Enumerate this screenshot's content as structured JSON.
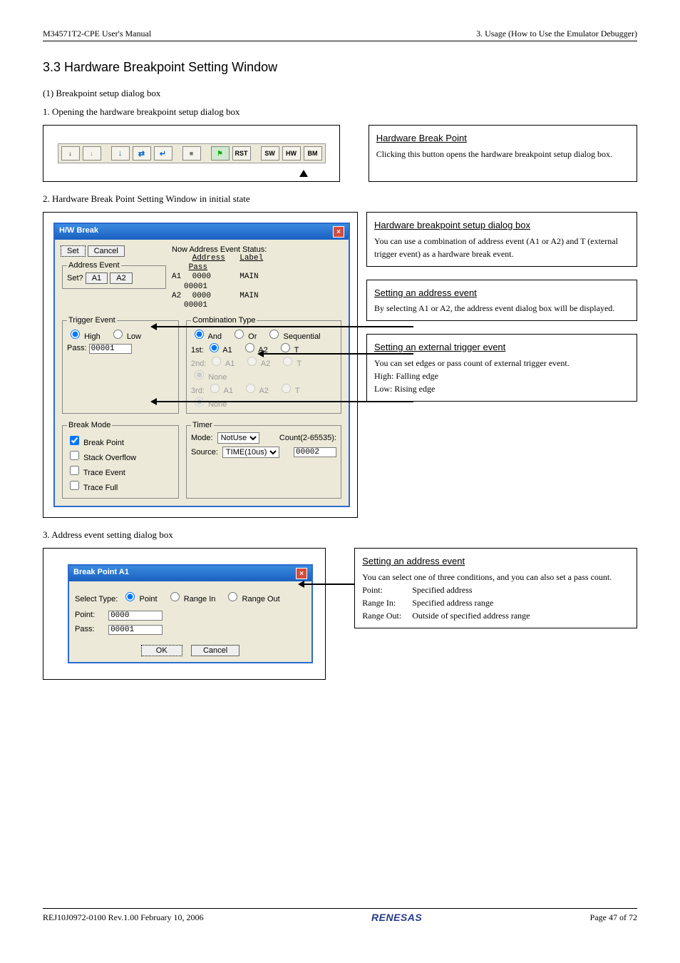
{
  "header": {
    "left": "M34571T2-CPE User's Manual",
    "right": "3. Usage (How to Use the Emulator Debugger)"
  },
  "section_title": "3.3 Hardware Breakpoint Setting Window",
  "p1": {
    "heading": "(1) Breakpoint setup dialog box",
    "step": "1. Opening the hardware breakpoint setup dialog box"
  },
  "toolbar": {
    "rst": "RST",
    "sw": "SW",
    "hw": "HW",
    "bm": "BM"
  },
  "callout_tb": {
    "title": "Hardware Break Point",
    "body": "Clicking this button opens the hardware breakpoint setup dialog box."
  },
  "step2": "2. Hardware Break Point Setting Window in initial state",
  "hw_win": {
    "title": "H/W Break",
    "set": "Set",
    "cancel": "Cancel",
    "addr_event": "Address Event",
    "set_q": "Set?",
    "a1": "A1",
    "a2": "A2",
    "status_label": "Now Address Event Status:",
    "status_hdr_addr": "Address",
    "status_hdr_label": "Label",
    "status_hdr_pass": "Pass",
    "status_rows": [
      {
        "ch": "A1",
        "addr": "0000",
        "label": "MAIN",
        "pass": "00001"
      },
      {
        "ch": "A2",
        "addr": "0000",
        "label": "MAIN",
        "pass": "00001"
      }
    ],
    "trigger_event": "Trigger Event",
    "high": "High",
    "low": "Low",
    "pass_lbl": "Pass:",
    "pass_val": "00001",
    "comb": "Combination Type",
    "and": "And",
    "or": "Or",
    "seq": "Sequential",
    "first": "1st:",
    "second": "2nd:",
    "third": "3rd:",
    "a1o": "A1",
    "a2o": "A2",
    "t": "T",
    "none": "None",
    "break_mode": "Break Mode",
    "bp": "Break Point",
    "so": "Stack Overflow",
    "te": "Trace Event",
    "tf": "Trace Full",
    "timer": "Timer",
    "mode": "Mode:",
    "mode_val": "NotUse",
    "count_lbl": "Count(2-65535):",
    "source": "Source:",
    "source_val": "TIME(10us)",
    "count_val": "00002"
  },
  "callouts2": [
    {
      "title": "Hardware breakpoint setup dialog box",
      "body": "You can use a combination of address event (A1 or A2) and T (external trigger event) as a hardware break event."
    },
    {
      "title": "Setting an address event",
      "body": "By selecting A1 or A2, the address event dialog box will be displayed."
    },
    {
      "title": "Setting an external trigger event",
      "body": "You can set edges or pass count of external trigger event.",
      "l1": "High: Falling edge",
      "l2": "Low: Rising edge"
    }
  ],
  "step3": "3. Address event setting dialog box",
  "bp_win": {
    "title": "Break Point A1",
    "select_type": "Select Type:",
    "point": "Point",
    "range_in": "Range In",
    "range_out": "Range Out",
    "point_lbl": "Point:",
    "point_val": "0000",
    "pass_lbl": "Pass:",
    "pass_val": "00001",
    "ok": "OK",
    "cancel": "Cancel"
  },
  "callout3": {
    "title": "Setting an address event",
    "body": "You can select one of three conditions, and you can also set a pass count.",
    "rows": [
      {
        "k": "Point:",
        "v": "Specified address"
      },
      {
        "k": "Range In:",
        "v": "Specified address range"
      },
      {
        "k": "Range Out:",
        "v": "Outside of specified address range"
      }
    ]
  },
  "footer": {
    "left": "REJ10J0972-0100   Rev.1.00   February 10, 2006",
    "brand": "RENESAS",
    "right": "Page 47 of 72"
  }
}
